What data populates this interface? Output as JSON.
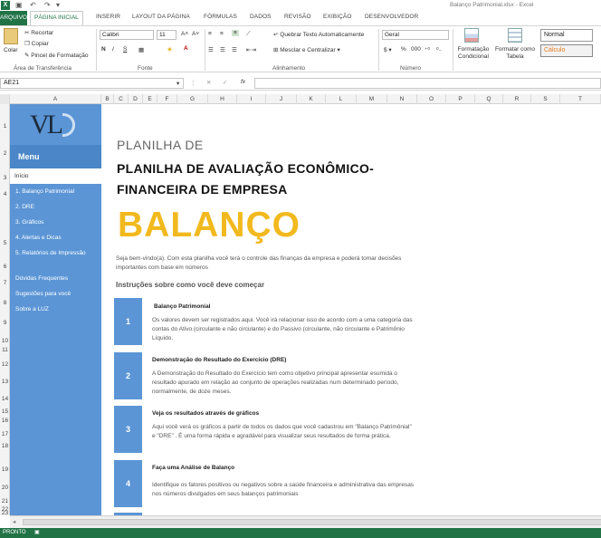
{
  "window": {
    "title": "Balanço Patrimonial.xlsx - Excel",
    "app_icon": "X"
  },
  "quick_access": [
    "save-icon",
    "undo-icon",
    "redo-icon",
    "customize-icon"
  ],
  "tabs": {
    "file": "ARQUIVO",
    "active": "PÁGINA INICIAL",
    "items": [
      "INSERIR",
      "LAYOUT DA PÁGINA",
      "FÓRMULAS",
      "DADOS",
      "REVISÃO",
      "EXIBIÇÃO",
      "DESENVOLVEDOR"
    ]
  },
  "ribbon": {
    "clipboard": {
      "paste": "Colar",
      "cut": "Recortar",
      "copy": "Copiar",
      "format_painter": "Pincel de Formatação",
      "group": "Área de Transferência"
    },
    "font": {
      "name": "Calibri",
      "size": "11",
      "bold": "N",
      "italic": "I",
      "underline": "S",
      "group": "Fonte"
    },
    "alignment": {
      "wrap": "Quebrar Texto Automaticamente",
      "merge": "Mesclar e Centralizar",
      "group": "Alinhamento"
    },
    "number": {
      "format": "Geral",
      "percent": "%",
      "thousands": "000",
      "group": "Número"
    },
    "styles": {
      "conditional": "Formatação Condicional",
      "table": "Formatar como Tabela",
      "normal": "Normal",
      "calc": "Cálculo"
    }
  },
  "formula_bar": {
    "name_box": "AE21",
    "fx": "fx",
    "value": ""
  },
  "columns": [
    "A",
    "B",
    "C",
    "D",
    "E",
    "F",
    "G",
    "H",
    "I",
    "J",
    "K",
    "L",
    "M",
    "N",
    "O",
    "P",
    "Q",
    "R",
    "S",
    "T"
  ],
  "rows": [
    "1",
    "2",
    "3",
    "4",
    "5",
    "6",
    "7",
    "8",
    "9",
    "10",
    "11",
    "12",
    "13",
    "14",
    "15",
    "16",
    "17",
    "18",
    "19",
    "20",
    "21",
    "22",
    "23"
  ],
  "sidebar": {
    "logo_text": "VL",
    "menu_title": "Menu",
    "items": [
      "Início",
      "1. Balanço Patrimonial",
      "2. DRE",
      "3. Gráficos",
      "4. Alertas e Dicas",
      "5. Relatórios de Impressão",
      "Dúvidas Frequentes",
      "Sugestões para você",
      "Sobre a LUZ"
    ]
  },
  "content": {
    "subtitle": "PLANILHA DE",
    "title": "PLANILHA DE AVALIAÇÃO ECONÔMICO-FINANCEIRA DE EMPRESA",
    "banner": "BALANÇO",
    "intro": "Seja bem-vindo(a). Com esta planilha você terá o controle das finanças da empresa e poderá tomar decisões importantes com base em números",
    "instructions_title": "Instruções sobre como você deve começar",
    "steps": [
      {
        "num": "1",
        "heading": "Balanço Patrimonial",
        "body": "Os valores devem ser registrados aqui. Você irá relacionar isso de acordo com  a uma categoria das contas do Ativo (circulante e não circulante) e do Passivo (circulante, não circulante e Patrimônio Líquido."
      },
      {
        "num": "2",
        "heading": "Demonstração do Resultado do Exercício (DRE)",
        "body": "A Demonstração do Resultado do Exercício tem como objetivo principal apresentar esumida o resultado apurado em relação ao conjunto de operações realizadas num determinado período, normalmente, de doze meses."
      },
      {
        "num": "3",
        "heading": "Veja os resultados através de gráficos",
        "body": "Aqui você verá os gráficos a partir de todos os dados que você cadastrou em \"Balanço Patrimônial\" e \"DRE\" . É uma forma rápida e agradável para visualizar seus resultados de forma prática."
      },
      {
        "num": "4",
        "heading": "Faça uma Análise de Balanço",
        "body": "Identifique os fatores positivos ou negativos sobre a saúde financeira e administrativa das empresas nos números divulgados em seus balanços patrimoniais"
      }
    ]
  },
  "status": {
    "text": "PRONTO"
  },
  "colors": {
    "excel_green": "#217346",
    "sidebar_blue": "#5b95d6",
    "banner_yellow": "#f2b91e"
  }
}
